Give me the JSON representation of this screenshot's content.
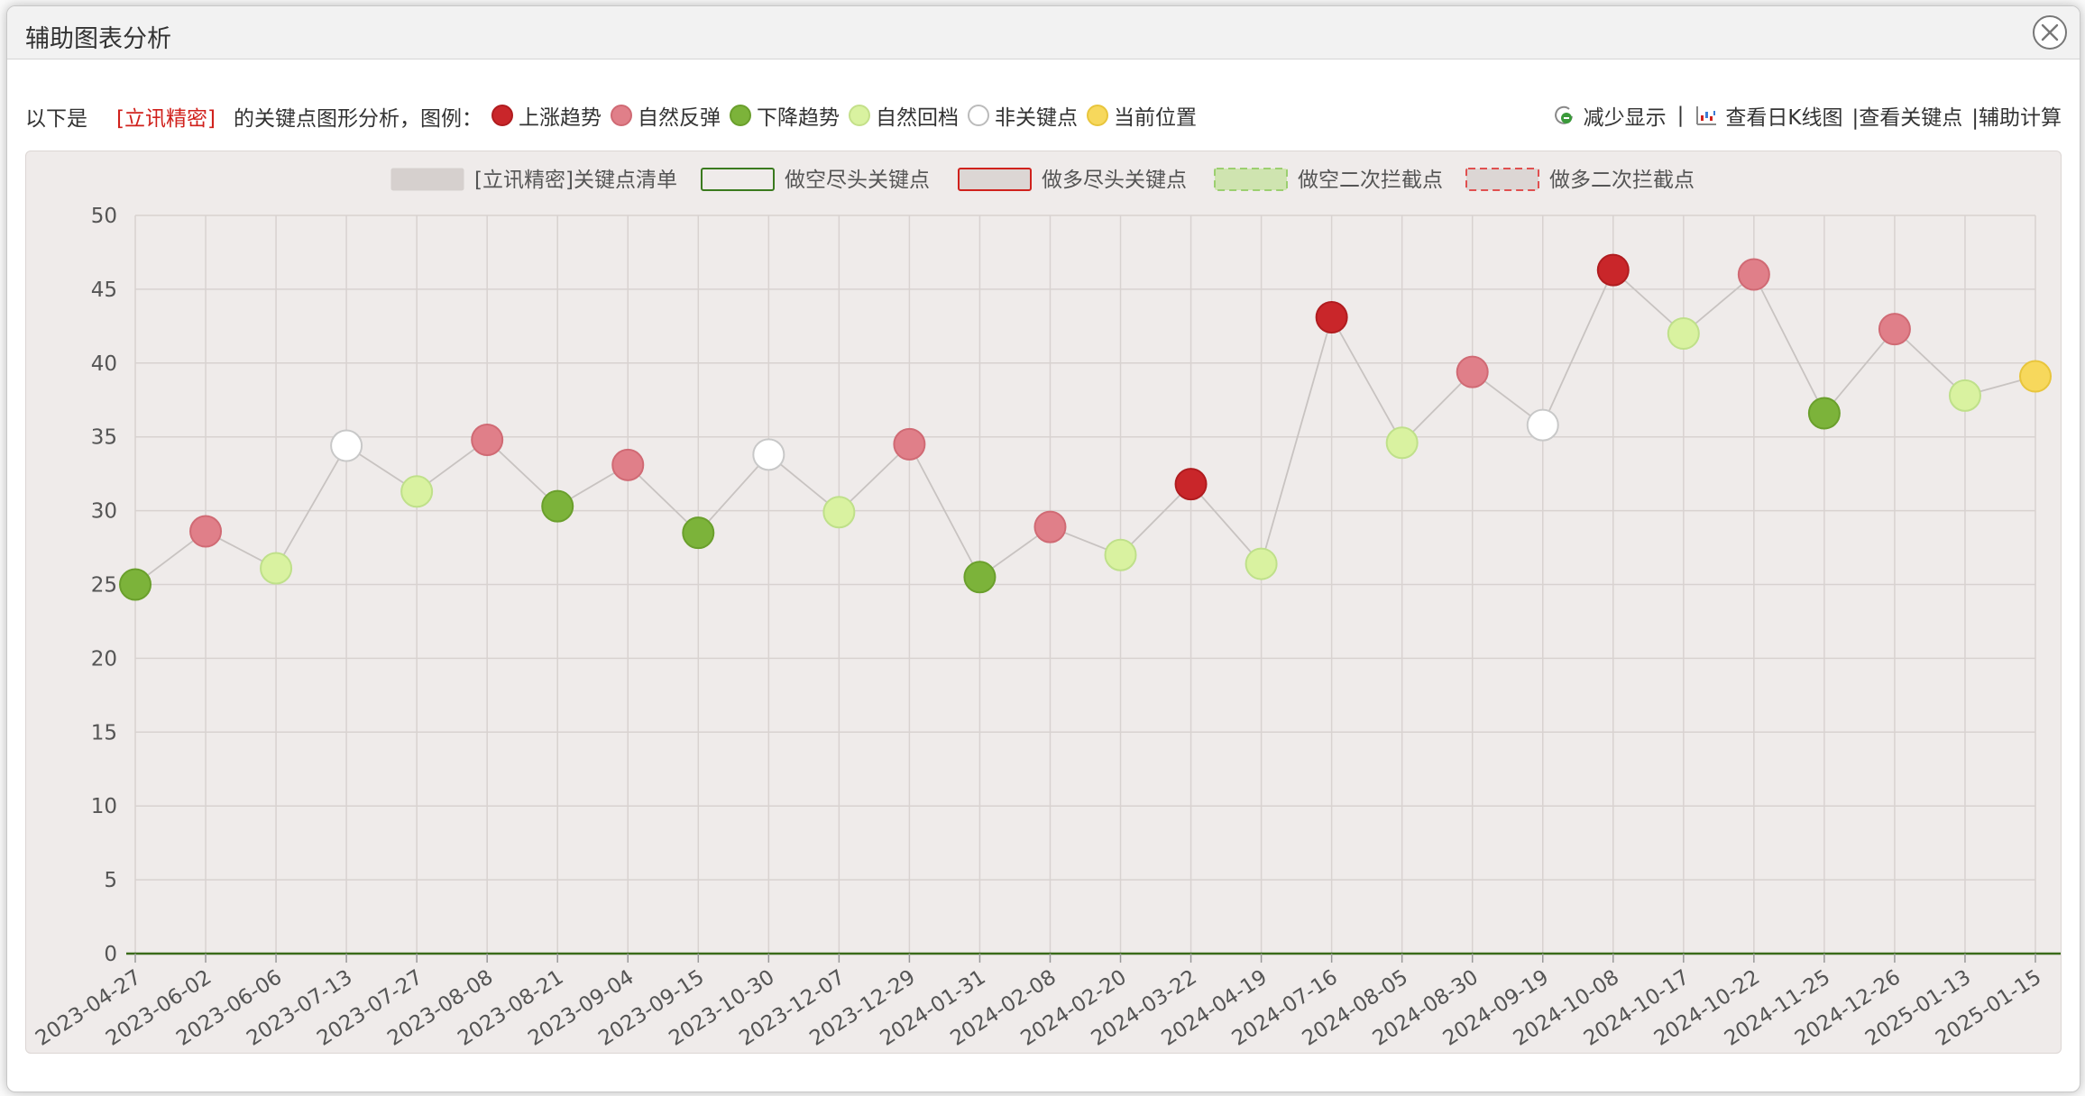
{
  "dialog": {
    "title": "辅助图表分析"
  },
  "info": {
    "prefix": "以下是",
    "stock": "[立讯精密]",
    "suffix": "的关键点图形分析，图例：",
    "legend": [
      {
        "label": "上涨趋势",
        "color": "#c9262a",
        "border": "#b01c1f"
      },
      {
        "label": "自然反弹",
        "color": "#e07f89",
        "border": "#d06a74"
      },
      {
        "label": "下降趋势",
        "color": "#7cb33a",
        "border": "#6a9f2c"
      },
      {
        "label": "自然回档",
        "color": "#d9f2a0",
        "border": "#c4e08a"
      },
      {
        "label": "非关键点",
        "color": "#ffffff",
        "border": "#bbbbbb"
      },
      {
        "label": "当前位置",
        "color": "#f7d85c",
        "border": "#e8c53c"
      }
    ],
    "links": {
      "reduce": "减少显示",
      "sep1": "|",
      "kline": "查看日K线图",
      "keypoints": "|查看关键点",
      "calc": "|辅助计算"
    }
  },
  "chart_data": {
    "type": "line",
    "legend": [
      {
        "label": "[立讯精密]关键点清单",
        "style": "fill"
      },
      {
        "label": "做空尽头关键点",
        "style": "green-border"
      },
      {
        "label": "做多尽头关键点",
        "style": "red-border"
      },
      {
        "label": "做空二次拦截点",
        "style": "green-dashed"
      },
      {
        "label": "做多二次拦截点",
        "style": "red-dashed"
      }
    ],
    "ylim": [
      0,
      50
    ],
    "yticks": [
      0,
      5,
      10,
      15,
      20,
      25,
      30,
      35,
      40,
      45,
      50
    ],
    "categories": [
      "2023-04-27",
      "2023-06-02",
      "2023-06-06",
      "2023-07-13",
      "2023-07-27",
      "2023-08-08",
      "2023-08-21",
      "2023-09-04",
      "2023-09-15",
      "2023-10-30",
      "2023-12-07",
      "2023-12-29",
      "2024-01-31",
      "2024-02-08",
      "2024-02-20",
      "2024-03-22",
      "2024-04-19",
      "2024-07-16",
      "2024-08-05",
      "2024-08-30",
      "2024-09-19",
      "2024-10-08",
      "2024-10-17",
      "2024-10-22",
      "2024-11-25",
      "2024-12-26",
      "2025-01-13",
      "2025-01-15"
    ],
    "values": [
      25.0,
      28.6,
      26.1,
      34.4,
      31.3,
      34.8,
      30.3,
      33.1,
      28.5,
      33.8,
      29.9,
      34.5,
      25.5,
      28.9,
      27.0,
      31.8,
      26.4,
      43.1,
      34.6,
      39.4,
      35.8,
      46.3,
      42.0,
      46.0,
      36.6,
      42.3,
      37.8,
      39.1
    ],
    "kinds": [
      "down",
      "rebound",
      "pullback",
      "non",
      "pullback",
      "rebound",
      "down",
      "rebound",
      "down",
      "non",
      "pullback",
      "rebound",
      "down",
      "rebound",
      "pullback",
      "up",
      "pullback",
      "up",
      "pullback",
      "rebound",
      "non",
      "up",
      "pullback",
      "rebound",
      "down",
      "rebound",
      "pullback",
      "current"
    ],
    "colors": {
      "up": "#c9262a",
      "rebound": "#e07f89",
      "down": "#7cb33a",
      "pullback": "#d9f2a0",
      "non": "#ffffff",
      "current": "#f7d85c"
    },
    "baseline_color": "#3a6b1a",
    "grid": true
  }
}
